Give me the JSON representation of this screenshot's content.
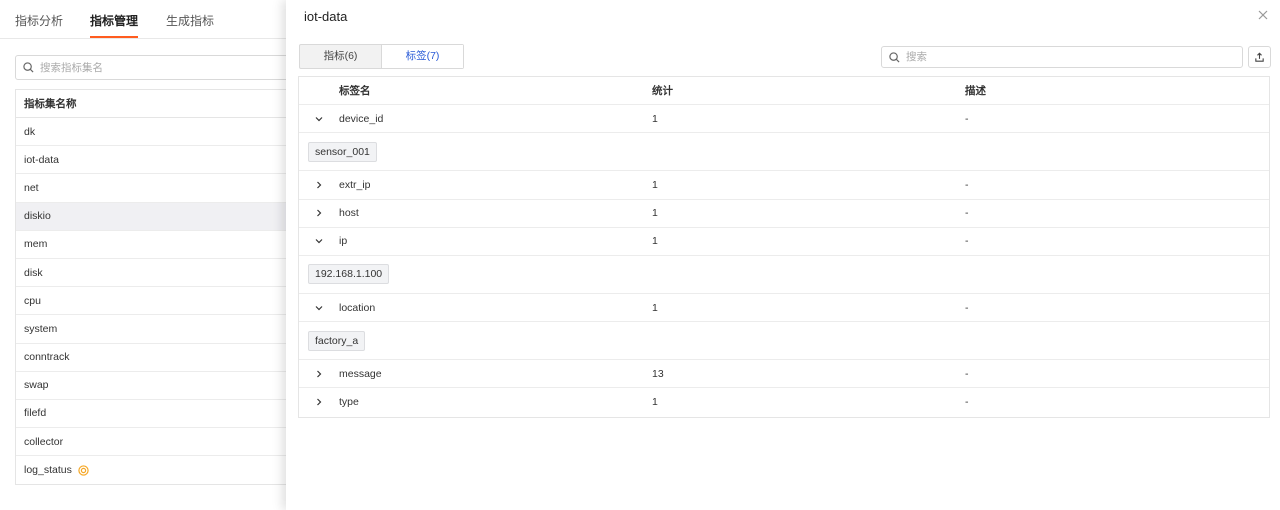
{
  "top_tabs": [
    {
      "label": "指标分析"
    },
    {
      "label": "指标管理"
    },
    {
      "label": "生成指标"
    }
  ],
  "left_search": {
    "placeholder": "搜索指标集名"
  },
  "set_table": {
    "header": "指标集名称",
    "rows": [
      "dk",
      "iot-data",
      "net",
      "diskio",
      "mem",
      "disk",
      "cpu",
      "system",
      "conntrack",
      "swap",
      "filefd",
      "collector",
      "log_status"
    ],
    "selected": "diskio"
  },
  "drawer": {
    "title": "iot-data",
    "tabs": [
      {
        "label": "指标(6)"
      },
      {
        "label": "标签(7)"
      }
    ],
    "active_tab": "标签(7)",
    "search": {
      "placeholder": "搜索"
    },
    "table": {
      "headers": {
        "name": "标签名",
        "count": "统计",
        "desc": "描述"
      },
      "rows": [
        {
          "name": "device_id",
          "count": "1",
          "desc": "-",
          "expanded": true,
          "values": [
            "sensor_001"
          ]
        },
        {
          "name": "extr_ip",
          "count": "1",
          "desc": "-",
          "expanded": false
        },
        {
          "name": "host",
          "count": "1",
          "desc": "-",
          "expanded": false
        },
        {
          "name": "ip",
          "count": "1",
          "desc": "-",
          "expanded": true,
          "values": [
            "192.168.1.100"
          ]
        },
        {
          "name": "location",
          "count": "1",
          "desc": "-",
          "expanded": true,
          "values": [
            "factory_a"
          ]
        },
        {
          "name": "message",
          "count": "13",
          "desc": "-",
          "expanded": false
        },
        {
          "name": "type",
          "count": "1",
          "desc": "-",
          "expanded": false
        }
      ]
    }
  },
  "colors": {
    "accent": "#ff5c1f",
    "active_tab_text": "#2a5bd7",
    "status_icon": "#f5a623"
  },
  "icons": {
    "search": "search-icon",
    "close": "close-icon",
    "export": "export-icon",
    "expand": "chevron-down-icon",
    "collapse": "chevron-right-icon",
    "status": "status-ring-icon"
  }
}
